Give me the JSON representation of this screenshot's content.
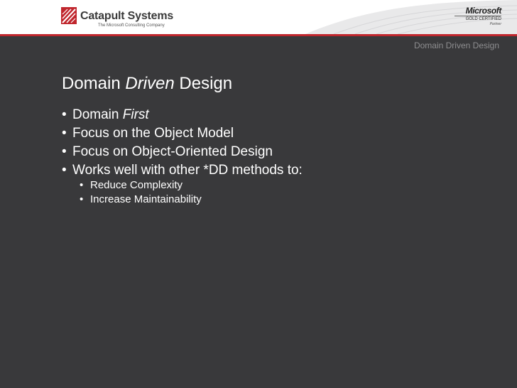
{
  "header": {
    "logo_name": "Catapult Systems",
    "logo_tagline": "The Microsoft Consulting Company",
    "partner_word": "Microsoft",
    "partner_level": "GOLD CERTIFIED",
    "partner_type": "Partner",
    "running_title": "Domain Driven Design"
  },
  "slide": {
    "title_before": "Domain ",
    "title_em": "Driven",
    "title_after": " Design",
    "bullets": [
      {
        "text": "Domain ",
        "em": "First"
      },
      {
        "text": "Focus on the Object Model"
      },
      {
        "text": "Focus on Object-Oriented Design"
      },
      {
        "text": "Works well with other *DD methods to:"
      }
    ],
    "sub_bullets": [
      "Reduce Complexity",
      "Increase Maintainability"
    ]
  },
  "colors": {
    "background": "#39393b",
    "header": "#ffffff",
    "accent_red": "#c0262d",
    "text": "#ffffff",
    "running_title": "#8e8e90"
  }
}
